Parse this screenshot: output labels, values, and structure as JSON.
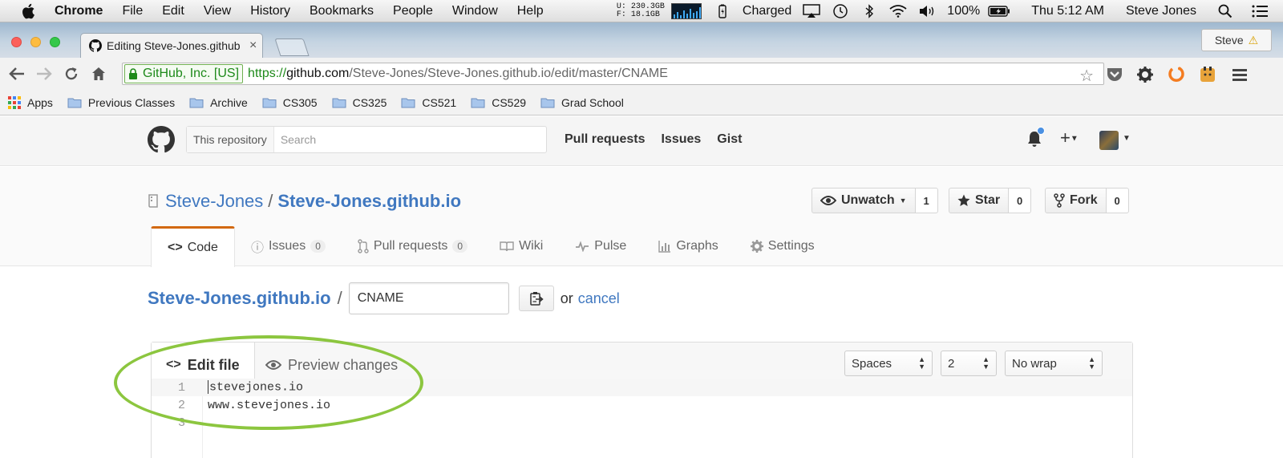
{
  "menubar": {
    "app": "Chrome",
    "items": [
      "File",
      "Edit",
      "View",
      "History",
      "Bookmarks",
      "People",
      "Window",
      "Help"
    ],
    "mem_u": "U: 230.3GB",
    "mem_f": "F:  18.1GB",
    "charged": "Charged",
    "battery": "100%",
    "clock": "Thu 5:12 AM",
    "user": "Steve Jones"
  },
  "browser": {
    "tab_title": "Editing Steve-Jones.github",
    "tab_close": "×",
    "profile": "Steve",
    "ev_label": "GitHub, Inc. [US]",
    "url_scheme": "https://",
    "url_host": "github.com",
    "url_path": "/Steve-Jones/Steve-Jones.github.io/edit/master/CNAME",
    "bookmarks": [
      "Apps",
      "Previous Classes",
      "Archive",
      "CS305",
      "CS325",
      "CS521",
      "CS529",
      "Grad School"
    ]
  },
  "github": {
    "search_scope": "This repository",
    "search_placeholder": "Search",
    "nav": [
      "Pull requests",
      "Issues",
      "Gist"
    ],
    "owner": "Steve-Jones",
    "repo_sep": "/",
    "repo": "Steve-Jones.github.io",
    "watch_label": "Unwatch",
    "watch_count": "1",
    "star_label": "Star",
    "star_count": "0",
    "fork_label": "Fork",
    "fork_count": "0",
    "tabs": {
      "code": "Code",
      "issues": "Issues",
      "issues_count": "0",
      "pulls": "Pull requests",
      "pulls_count": "0",
      "wiki": "Wiki",
      "pulse": "Pulse",
      "graphs": "Graphs",
      "settings": "Settings"
    }
  },
  "edit": {
    "breadcrumb_repo": "Steve-Jones.github.io",
    "breadcrumb_sep": "/",
    "filename": "CNAME",
    "or": "or",
    "cancel": "cancel",
    "tab_edit": "Edit file",
    "tab_preview": "Preview changes",
    "indent_mode": "Spaces",
    "indent_size": "2",
    "wrap_mode": "No wrap",
    "lines": [
      {
        "num": "1",
        "text": "stevejones.io"
      },
      {
        "num": "2",
        "text": "www.stevejones.io"
      },
      {
        "num": "3",
        "text": ""
      }
    ]
  },
  "colors": {
    "link": "#4078c0",
    "active_tab_accent": "#d26911",
    "annotation": "#8cc63f",
    "ev_green": "#1e8a1a"
  }
}
